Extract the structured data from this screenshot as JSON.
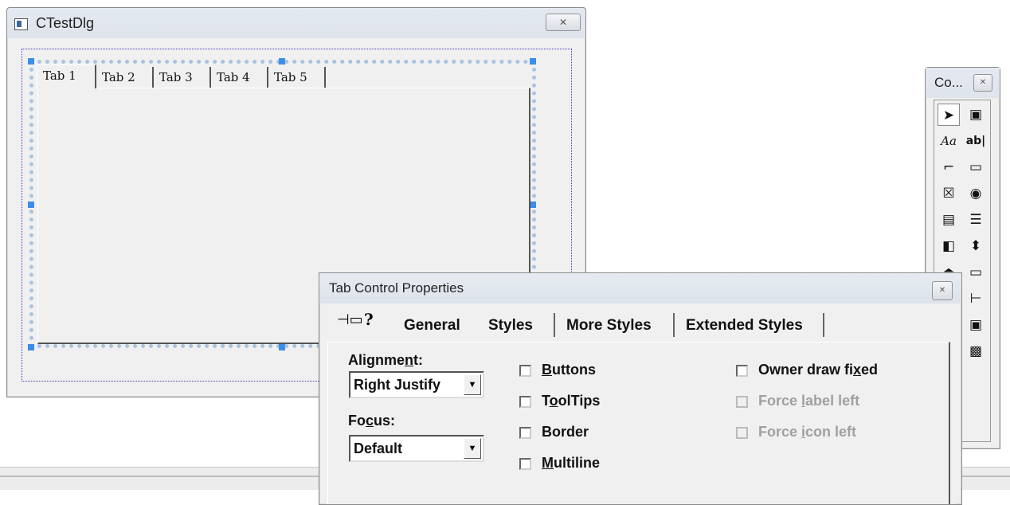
{
  "test_dialog": {
    "title": "CTestDlg",
    "tabs": [
      "Tab 1",
      "Tab 2",
      "Tab 3",
      "Tab 4",
      "Tab 5"
    ]
  },
  "controls_toolbox": {
    "title": "Co...",
    "close_glyph": "✕",
    "tools": [
      {
        "name": "pointer",
        "glyph": "➤"
      },
      {
        "name": "picture",
        "glyph": "▣"
      },
      {
        "name": "static-text",
        "glyph": "Aa"
      },
      {
        "name": "edit-box",
        "glyph": "ab|"
      },
      {
        "name": "group-box",
        "glyph": "⌐"
      },
      {
        "name": "button",
        "glyph": "▭"
      },
      {
        "name": "check-box",
        "glyph": "☒"
      },
      {
        "name": "radio-button",
        "glyph": "◉"
      },
      {
        "name": "combo-box",
        "glyph": "▤"
      },
      {
        "name": "list-box",
        "glyph": "☰"
      },
      {
        "name": "horizontal-scrollbar",
        "glyph": "◧"
      },
      {
        "name": "vertical-scrollbar",
        "glyph": "⬍"
      },
      {
        "name": "spin",
        "glyph": "⏏"
      },
      {
        "name": "progress",
        "glyph": "▭"
      },
      {
        "name": "slider",
        "glyph": "⇌"
      },
      {
        "name": "tree-control",
        "glyph": "⊢"
      },
      {
        "name": "tab-control",
        "glyph": "▦"
      },
      {
        "name": "animate",
        "glyph": "▣"
      },
      {
        "name": "rich-edit",
        "glyph": "⋯"
      },
      {
        "name": "date-time",
        "glyph": "▩"
      }
    ]
  },
  "tab_props": {
    "title": "Tab Control Properties",
    "close_glyph": "✕",
    "pin_glyph": "⊣▭",
    "help_glyph": "?",
    "tabs": [
      "General",
      "Styles",
      "More Styles",
      "Extended Styles"
    ],
    "active_tab": "Styles",
    "alignment": {
      "label_pre": "Alignme",
      "label_u": "n",
      "label_post": "t:",
      "value": "Right Justify"
    },
    "focus": {
      "label_pre": "Fo",
      "label_u": "c",
      "label_post": "us:",
      "value": "Default"
    },
    "checkboxes_col1": [
      {
        "pre": "",
        "u": "B",
        "post": "uttons",
        "checked": false
      },
      {
        "pre": "T",
        "u": "o",
        "post": "olTips",
        "checked": false
      },
      {
        "pre": "",
        "u": "",
        "post": "Border",
        "checked": false
      },
      {
        "pre": "",
        "u": "M",
        "post": "ultiline",
        "checked": false
      }
    ],
    "checkboxes_col2": [
      {
        "pre": "Owner draw fi",
        "u": "x",
        "post": "ed",
        "checked": false,
        "enabled": true
      },
      {
        "pre": "Force ",
        "u": "l",
        "post": "abel left",
        "checked": false,
        "enabled": false
      },
      {
        "pre": "Force ",
        "u": "i",
        "post": "con left",
        "checked": false,
        "enabled": false
      }
    ],
    "combo_arrow": "▼"
  }
}
